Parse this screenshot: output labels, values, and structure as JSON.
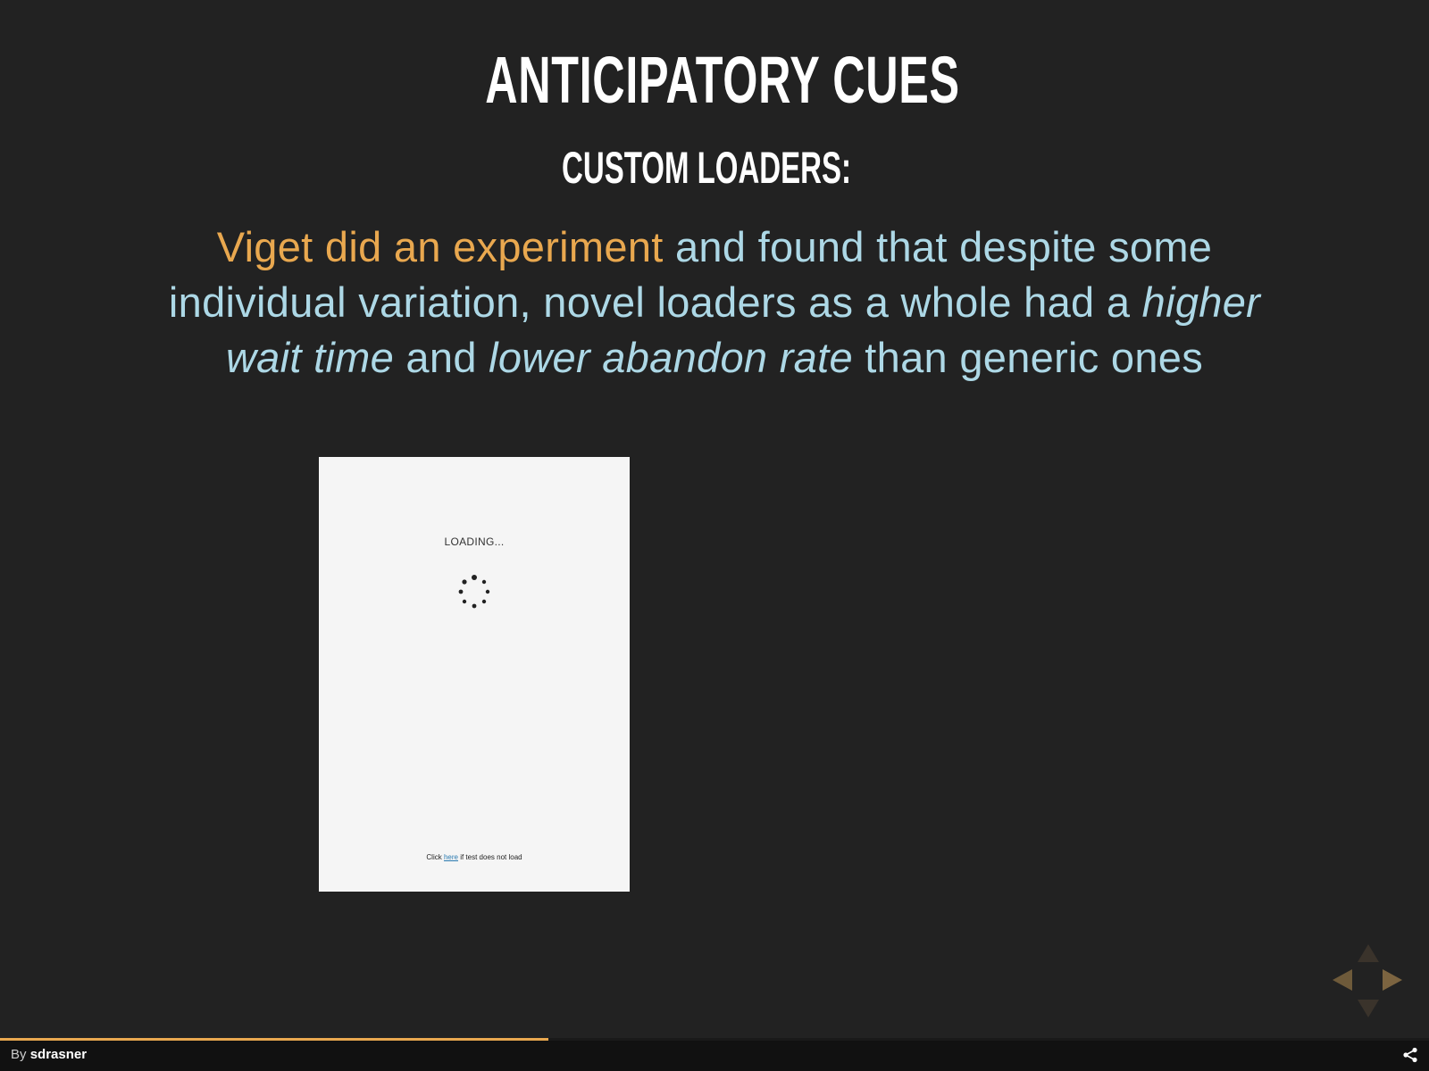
{
  "slide": {
    "title": "ANTICIPATORY CUES",
    "subtitle": "CUSTOM LOADERS:",
    "body": {
      "highlight": "Viget did an experiment",
      "part1": " and found that despite some individual variation, novel loaders as a whole had a ",
      "em1": "higher wait time",
      "part2": " and ",
      "em2": "lower abandon rate",
      "part3": " than generic ones"
    },
    "colors": {
      "background": "#222222",
      "highlight": "#e9a84f",
      "body_text": "#add8e6",
      "heading": "#ffffff"
    }
  },
  "loader_screenshot": {
    "loading_text": "LOADING...",
    "spinner_icon": "dotted-spinner-icon",
    "footer_prefix": "Click ",
    "footer_link": "here",
    "footer_suffix": " if test does not load"
  },
  "navigation": {
    "icons": [
      "arrow-up-icon",
      "arrow-down-icon",
      "arrow-left-icon",
      "arrow-right-icon"
    ]
  },
  "footer": {
    "by_label": "By",
    "author": "sdrasner",
    "progress_fraction": 0.384,
    "share_icon": "share-icon"
  }
}
